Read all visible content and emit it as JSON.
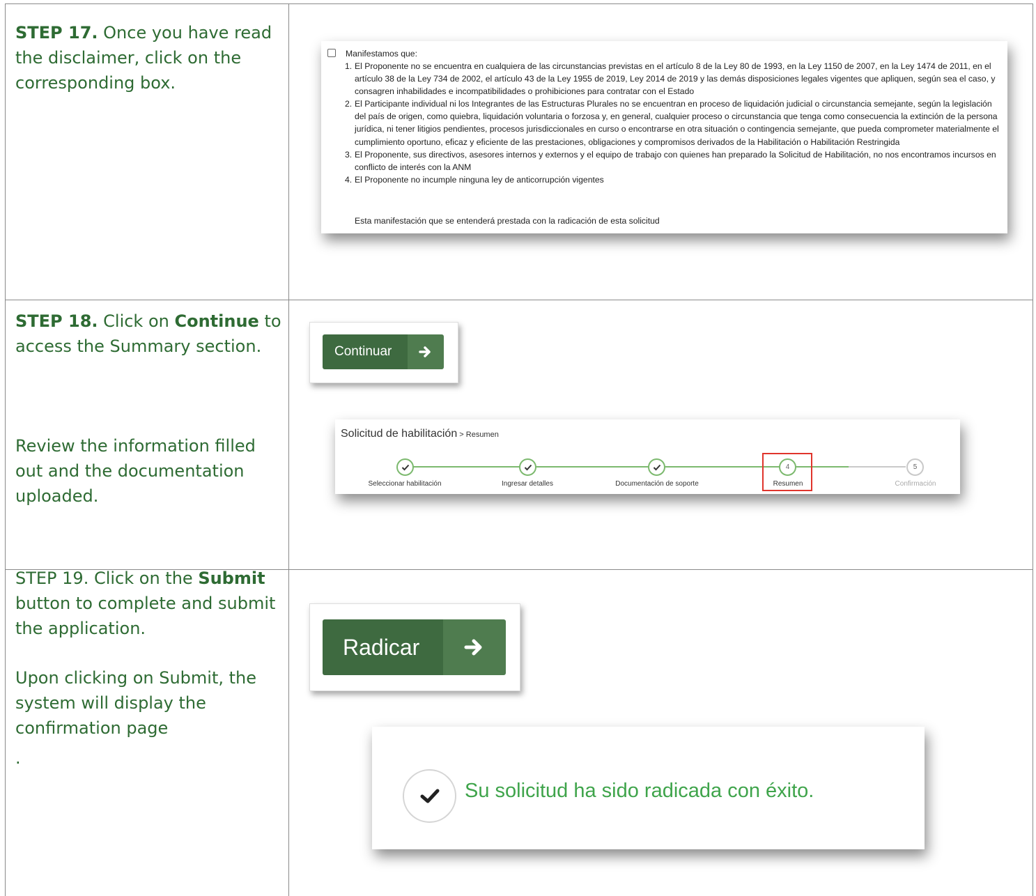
{
  "steps": {
    "s17": {
      "label": "STEP 17.",
      "text": " Once you have read the disclaimer, click on the corresponding box."
    },
    "s18": {
      "label": "STEP 18.",
      "pre": " Click on ",
      "bold": "Continue",
      "post": " to access the Summary section.",
      "review": "Review the information filled out and the documentation uploaded."
    },
    "s19": {
      "pre": "STEP 19. Click on the ",
      "bold": "Submit",
      "post": " button to complete and submit the application.",
      "after": "Upon clicking on Submit, the system will display the confirmation page",
      "dot": "."
    }
  },
  "disclaimer": {
    "intro": "Manifestamos que:",
    "items": [
      {
        "num": "1.",
        "text": "El Proponente no se encuentra en cualquiera de las circunstancias previstas en el artículo 8 de la Ley 80 de 1993, en la Ley 1150 de 2007, en la Ley 1474 de 2011, en el artículo 38 de la Ley 734 de 2002, el artículo 43 de la Ley 1955 de 2019, Ley 2014 de 2019 y las demás disposiciones legales vigentes que apliquen, según sea el caso, y consagren inhabilidades e incompatibilidades o prohibiciones para contratar con el Estado"
      },
      {
        "num": "2.",
        "text": "El Participante individual ni los Integrantes de las Estructuras Plurales no se encuentran en proceso de liquidación judicial o circunstancia semejante, según la legislación del país de origen, como quiebra, liquidación voluntaria o forzosa y, en general, cualquier proceso o circunstancia que tenga como consecuencia la extinción de la persona jurídica, ni tener litigios pendientes, procesos jurisdiccionales en curso o encontrarse en otra situación o contingencia semejante, que pueda comprometer materialmente el cumplimiento oportuno, eficaz y eficiente de las prestaciones, obligaciones y compromisos derivados de la Habilitación o Habilitación Restringida"
      },
      {
        "num": "3.",
        "text": "El Proponente, sus directivos, asesores internos y externos y el equipo de trabajo con quienes han preparado la Solicitud de Habilitación, no nos encontramos incursos en conflicto de interés con la ANM"
      },
      {
        "num": "4.",
        "text": "El Proponente no incumple ninguna ley de anticorrupción vigentes"
      }
    ],
    "closing": "Esta manifestación que se entenderá prestada con la radicación de esta solicitud"
  },
  "buttons": {
    "continue": "Continuar",
    "submit": "Radicar"
  },
  "stepper": {
    "title": "Solicitud de habilitación",
    "crumb": " > Resumen",
    "steps": [
      {
        "label": "Seleccionar habilitación",
        "state": "done"
      },
      {
        "label": "Ingresar detalles",
        "state": "done"
      },
      {
        "label": "Documentación de soporte",
        "state": "done"
      },
      {
        "label": "Resumen",
        "state": "current",
        "num": "4"
      },
      {
        "label": "Confirmación",
        "state": "todo",
        "num": "5"
      }
    ]
  },
  "confirmation": {
    "message": "Su solicitud ha sido radicada con éxito."
  },
  "colors": {
    "text_green": "#2e6b33",
    "button_green": "#3e6a40",
    "step_green": "#7cb96e",
    "success_green": "#3fa44b",
    "highlight_red": "#e0342c"
  },
  "icons": {
    "arrow": "arrow-right-icon",
    "check": "check-icon"
  }
}
